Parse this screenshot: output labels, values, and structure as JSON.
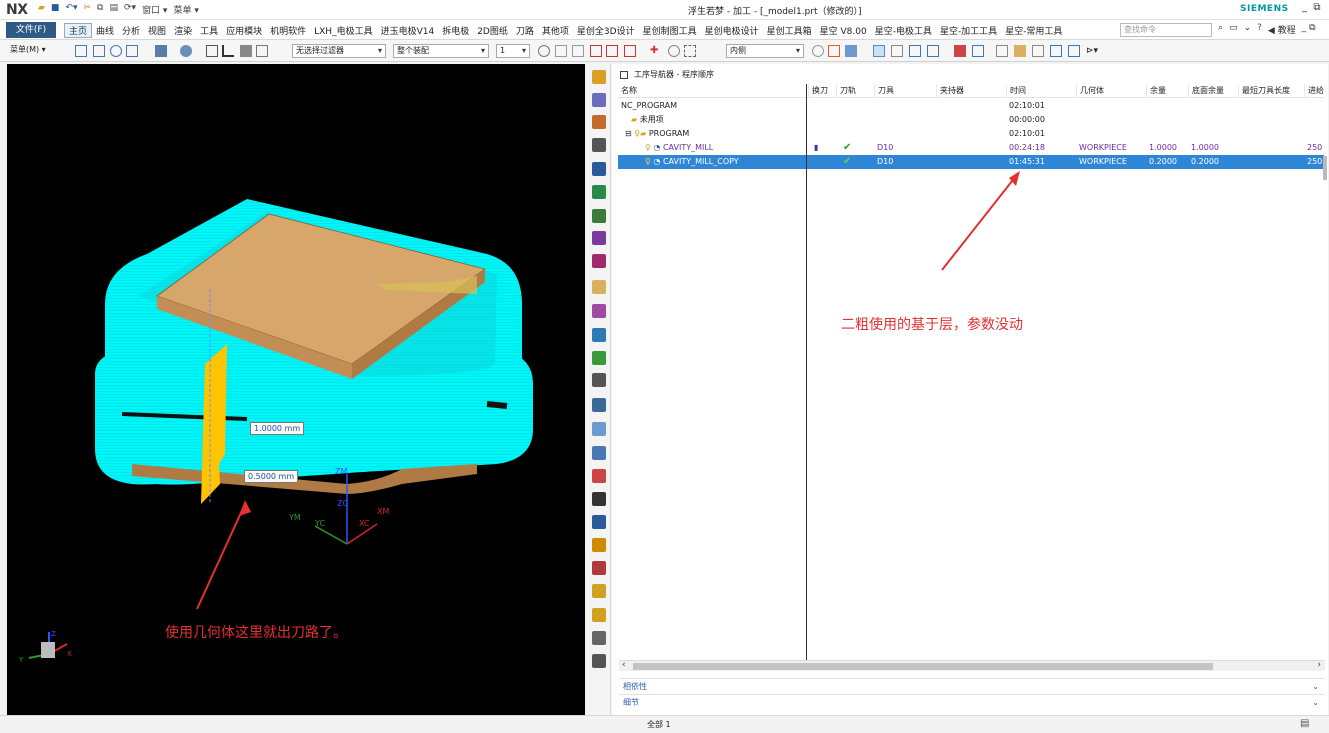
{
  "titlebar": {
    "logo": "NX",
    "window_title": "浮生若梦 - 加工 - [_model1.prt（修改的）]",
    "brand": "SIEMENS",
    "quick_access": [
      "窗口 ▾",
      "菜单 ▾"
    ]
  },
  "menubar": {
    "file": "文件(F)",
    "tabs": [
      "主页",
      "曲线",
      "分析",
      "视图",
      "渲染",
      "工具",
      "应用模块",
      "机明软件",
      "LXH_电极工具",
      "进玉电极V14",
      "拆电极",
      "2D图纸",
      "刀路",
      "其他项",
      "星创全3D设计",
      "星创制图工具",
      "星创电极设计",
      "星创工具箱",
      "星空 V8.00",
      "星空-电极工具",
      "星空-加工工具",
      "星空-常用工具"
    ],
    "active_tab": "主页",
    "search_placeholder": "查找命令",
    "help_label": "教程"
  },
  "toolbar": {
    "menu_label": "菜单(M) ▾",
    "filter_select": "无选择过滤器",
    "assembly_select": "整个装配",
    "number_select": "1",
    "face_select": "内侧"
  },
  "navigator": {
    "title": "工序导航器 - 程序顺序",
    "columns": [
      "名称",
      "换刀",
      "刀轨",
      "刀具",
      "夹持器",
      "时间",
      "几何体",
      "余量",
      "底面余量",
      "最短刀具长度",
      "进给"
    ],
    "rows": [
      {
        "name": "NC_PROGRAM",
        "time": "02:10:01"
      },
      {
        "name": "未用项",
        "time": "00:00:00"
      },
      {
        "name": "PROGRAM",
        "time": "02:10:01"
      },
      {
        "name": "CAVITY_MILL",
        "tool": "D10",
        "time": "00:24:18",
        "geometry": "WORKPIECE",
        "stock": "1.0000",
        "floor_stock": "1.0000",
        "feed": "250"
      },
      {
        "name": "CAVITY_MILL_COPY",
        "tool": "D10",
        "time": "01:45:31",
        "geometry": "WORKPIECE",
        "stock": "0.2000",
        "floor_stock": "0.2000",
        "feed": "250"
      }
    ],
    "sections": [
      "相依性",
      "细节"
    ]
  },
  "viewport": {
    "dim_label_1": "1.0000 mm",
    "dim_label_2": "0.5000 mm",
    "axis_labels": [
      "ZM",
      "ZC",
      "XC",
      "XM",
      "YC",
      "YM"
    ],
    "triad_labels": [
      "Z",
      "Y",
      "X"
    ]
  },
  "annotations": {
    "left": "使用几何体这里就出刀路了。",
    "right": "二粗使用的基于层，参数没动"
  },
  "status": {
    "text": "全部 1"
  },
  "colors": {
    "accent": "#2f86d6",
    "annotation": "#e53030",
    "toolpath": "#00f0f0",
    "part_top": "#d6a66a",
    "ops_purple": "#6a2ca0"
  }
}
